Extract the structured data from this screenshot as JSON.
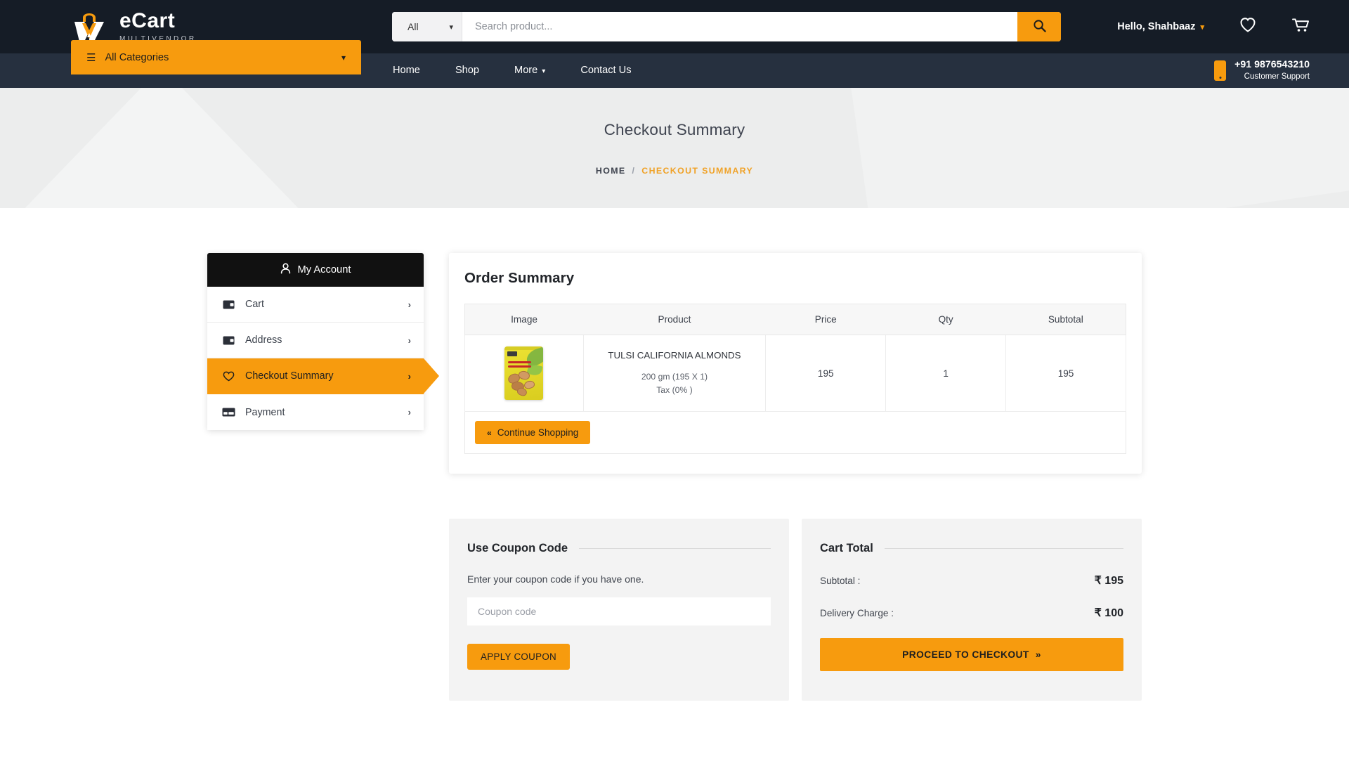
{
  "brand": {
    "name": "eCart",
    "tagline": "MULTIVENDOR",
    "accent": "#f79b0e",
    "header_bg": "#151c26",
    "nav_bg": "#26303f"
  },
  "header": {
    "search_category": "All",
    "search_placeholder": "Search product...",
    "search_value": "",
    "account_greeting": "Hello, Shahbaaz",
    "wishlist_icon": "heart-icon",
    "cart_icon": "cart-icon",
    "search_icon": "search-icon"
  },
  "nav": {
    "all_categories": "All Categories",
    "links": [
      {
        "label": "Home",
        "has_caret": false
      },
      {
        "label": "Shop",
        "has_caret": false
      },
      {
        "label": "More",
        "has_caret": true
      },
      {
        "label": "Contact Us",
        "has_caret": false
      }
    ],
    "support_number": "+91 9876543210",
    "support_label": "Customer Support"
  },
  "banner": {
    "title": "Checkout Summary",
    "breadcrumb_home": "HOME",
    "breadcrumb_sep": "/",
    "breadcrumb_current": "CHECKOUT SUMMARY"
  },
  "sidebar": {
    "header": "My Account",
    "header_icon": "user-icon",
    "items": [
      {
        "label": "Cart",
        "icon": "wallet-icon",
        "active": false
      },
      {
        "label": "Address",
        "icon": "wallet-icon",
        "active": false
      },
      {
        "label": "Checkout Summary",
        "icon": "heart-icon",
        "active": true
      },
      {
        "label": "Payment",
        "icon": "credit-card-icon",
        "active": false
      }
    ],
    "arrow": "›"
  },
  "order_summary": {
    "title": "Order Summary",
    "columns": [
      "Image",
      "Product",
      "Price",
      "Qty",
      "Subtotal"
    ],
    "rows": [
      {
        "image_alt": "tulsi-california-almonds-pack",
        "product": "TULSI CALIFORNIA ALMONDS",
        "variant": "200 gm (195 X 1)",
        "tax": "Tax (0% )",
        "price": "195",
        "qty": "1",
        "subtotal": "195"
      }
    ],
    "continue_shopping": "Continue Shopping",
    "continue_icon": "«"
  },
  "coupon": {
    "title": "Use Coupon Code",
    "note": "Enter your coupon code if you have one.",
    "placeholder": "Coupon code",
    "value": "",
    "apply_label": "APPLY COUPON"
  },
  "cart_total": {
    "title": "Cart Total",
    "rows": [
      {
        "label": "Subtotal :",
        "value": "₹ 195"
      },
      {
        "label": "Delivery Charge :",
        "value": "₹ 100"
      }
    ],
    "checkout_label": "PROCEED TO CHECKOUT",
    "checkout_icon": "»"
  }
}
